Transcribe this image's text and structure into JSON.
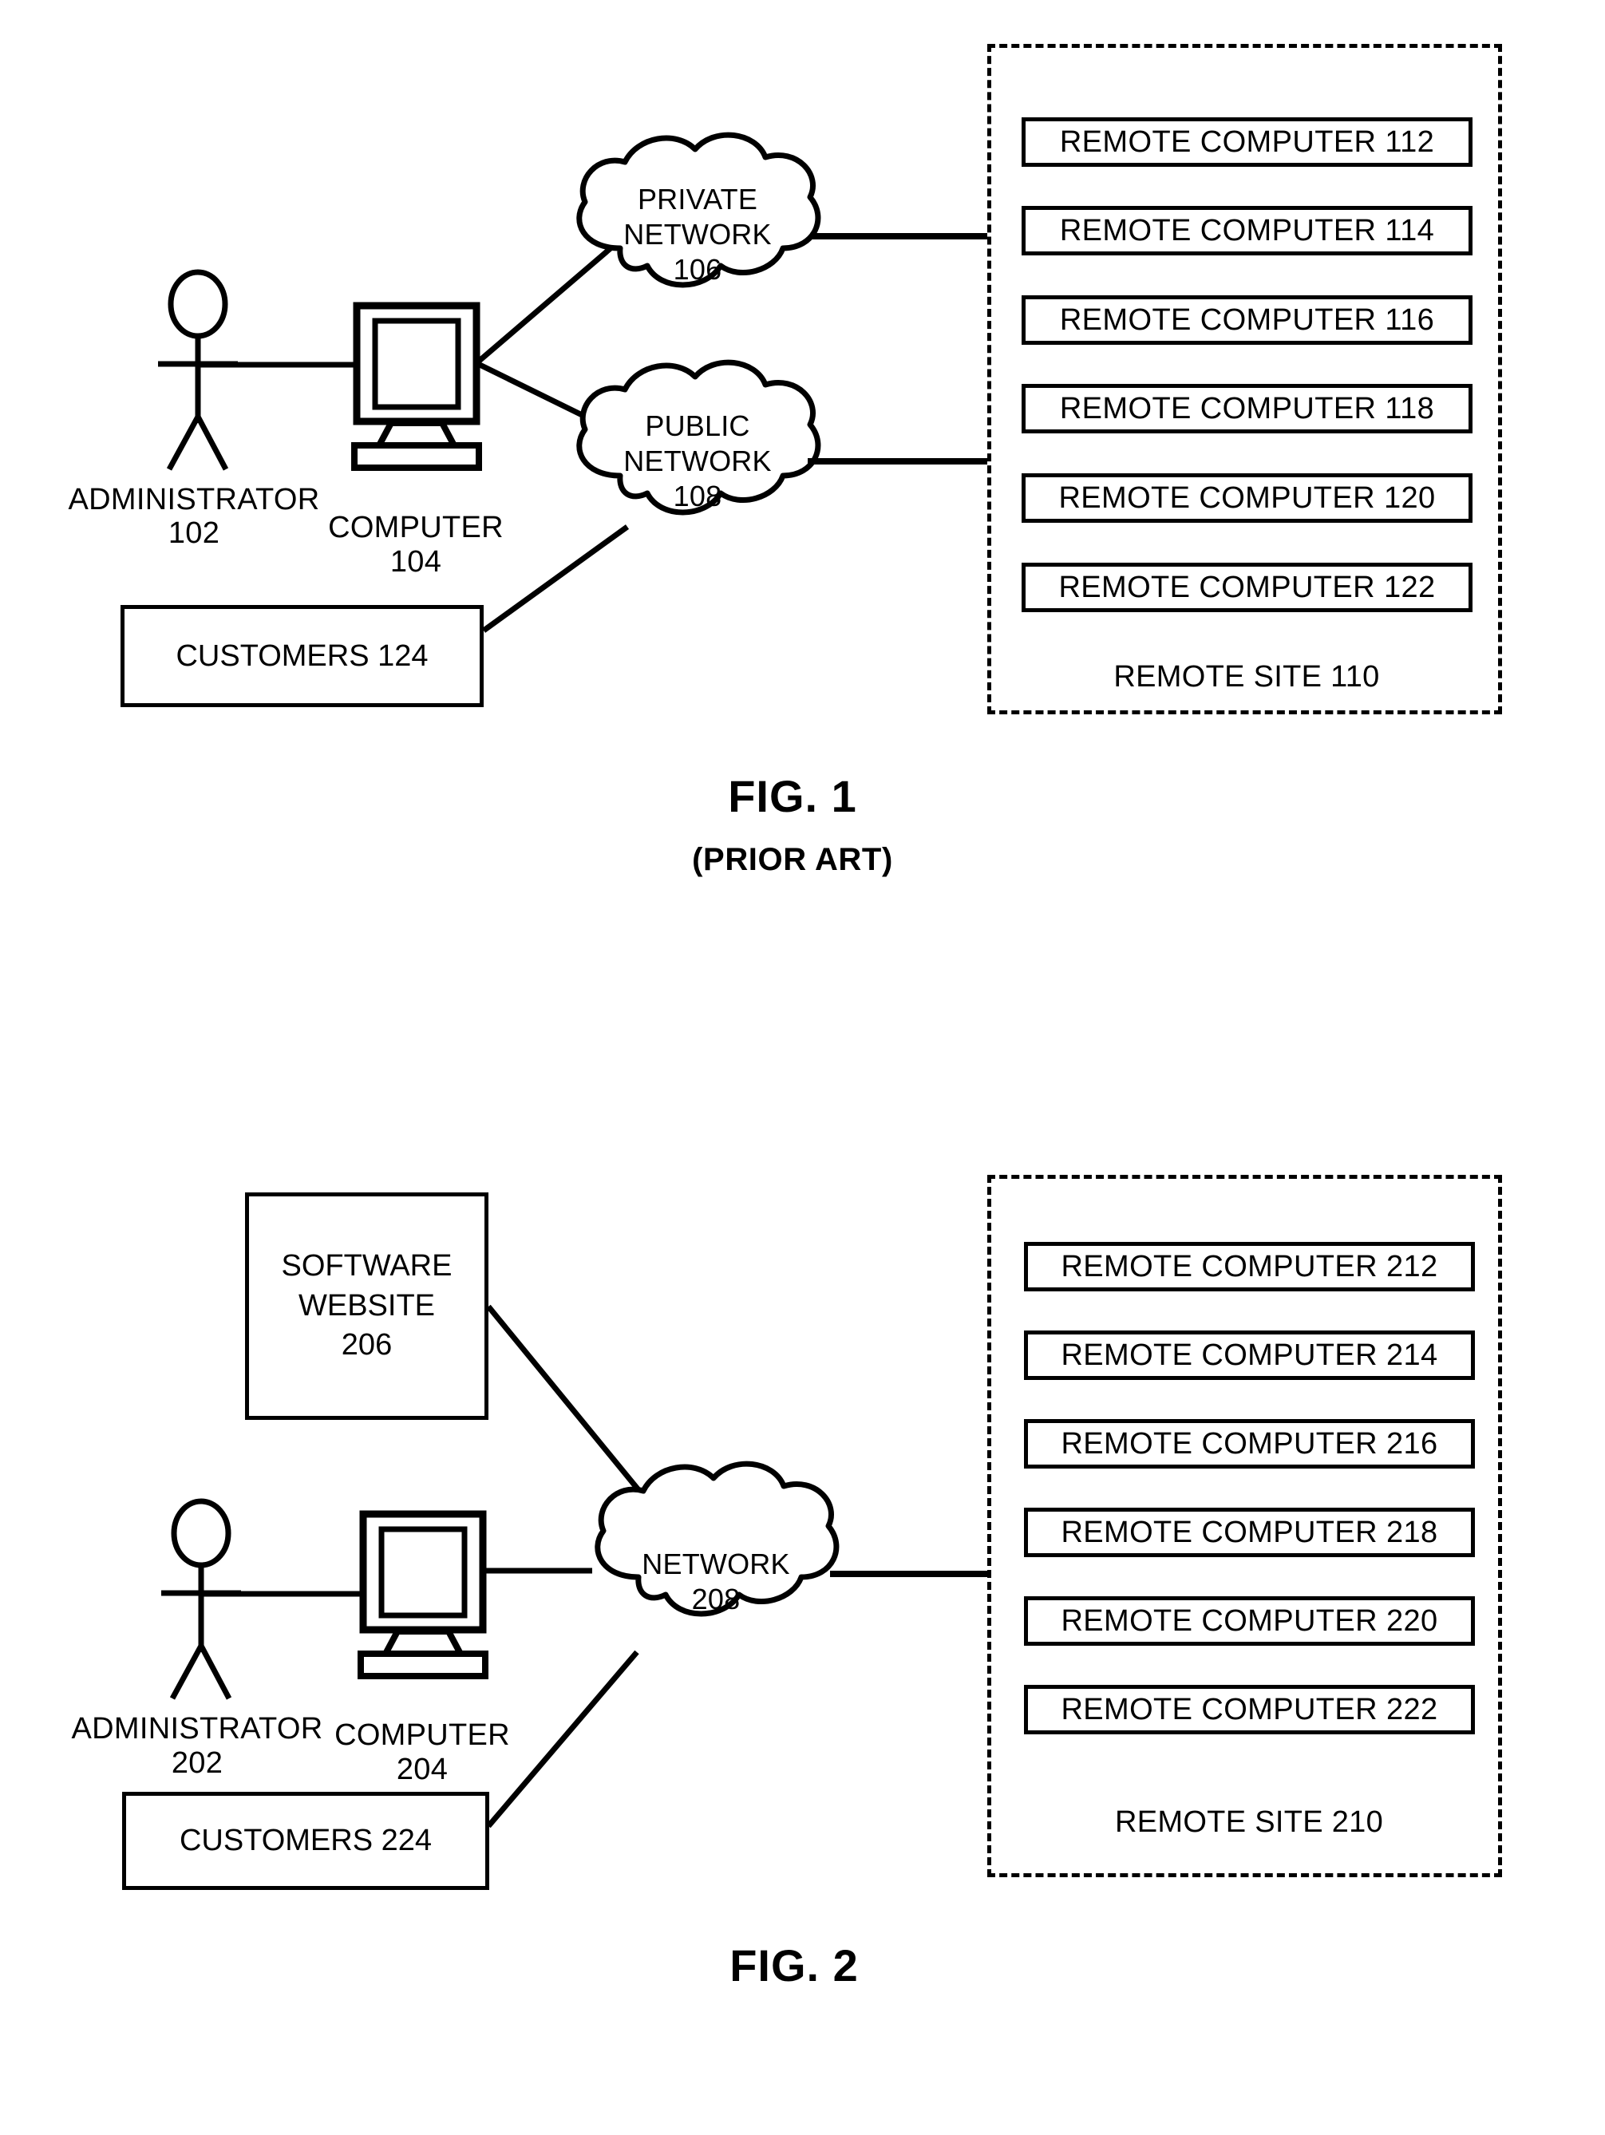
{
  "document": {
    "type": "patent-drawing-sheet",
    "figures": [
      {
        "id": "fig1",
        "caption": "FIG. 1",
        "subcaption": "(PRIOR ART)",
        "actor": {
          "label": "ADMINISTRATOR",
          "number": "102",
          "icon": "stick-figure-icon"
        },
        "workstation": {
          "label": "COMPUTER",
          "number": "104",
          "icon": "desktop-computer-icon"
        },
        "customers": {
          "label": "CUSTOMERS 124"
        },
        "clouds": [
          {
            "name": "private-network",
            "line1": "PRIVATE",
            "line2": "NETWORK",
            "number": "106"
          },
          {
            "name": "public-network",
            "line1": "PUBLIC",
            "line2": "NETWORK",
            "number": "108"
          }
        ],
        "remote_site": {
          "label": "REMOTE SITE 110",
          "computers": [
            "REMOTE COMPUTER 112",
            "REMOTE COMPUTER 114",
            "REMOTE COMPUTER 116",
            "REMOTE COMPUTER 118",
            "REMOTE COMPUTER 120",
            "REMOTE COMPUTER 122"
          ]
        }
      },
      {
        "id": "fig2",
        "caption": "FIG. 2",
        "subcaption": "",
        "actor": {
          "label": "ADMINISTRATOR",
          "number": "202",
          "icon": "stick-figure-icon"
        },
        "workstation": {
          "label": "COMPUTER",
          "number": "204",
          "icon": "desktop-computer-icon"
        },
        "customers": {
          "label": "CUSTOMERS 224"
        },
        "website": {
          "line1": "SOFTWARE",
          "line2": "WEBSITE",
          "number": "206"
        },
        "clouds": [
          {
            "name": "network",
            "line1": "NETWORK",
            "line2": "",
            "number": "208"
          }
        ],
        "remote_site": {
          "label": "REMOTE SITE 210",
          "computers": [
            "REMOTE COMPUTER 212",
            "REMOTE COMPUTER 214",
            "REMOTE COMPUTER 216",
            "REMOTE COMPUTER 218",
            "REMOTE COMPUTER 220",
            "REMOTE COMPUTER 222"
          ]
        }
      }
    ]
  },
  "colors": {
    "ink": "#000000",
    "paper": "#ffffff"
  }
}
